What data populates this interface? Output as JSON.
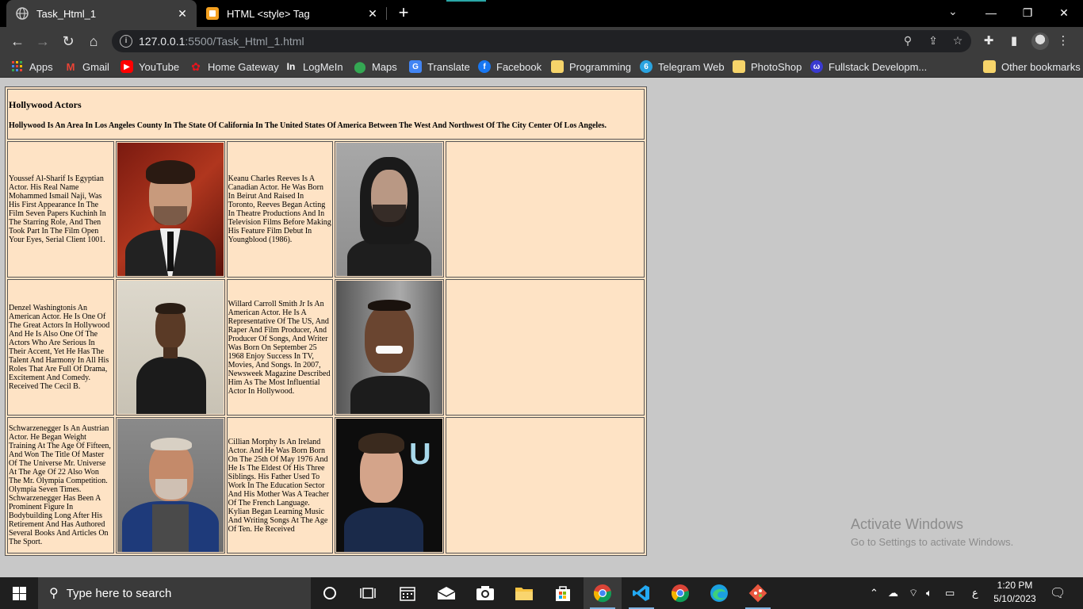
{
  "browser": {
    "tabs": [
      {
        "title": "Task_Html_1",
        "active": true,
        "icon": "globe-icon"
      },
      {
        "title": "HTML <style> Tag",
        "active": false,
        "icon": "w3schools-icon"
      }
    ],
    "url_host": "127.0.0.1",
    "url_path": ":5500/Task_Html_1.html",
    "bookmarks": [
      {
        "label": "Apps",
        "icon": "apps-grid-icon"
      },
      {
        "label": "Gmail",
        "icon": "gmail-icon"
      },
      {
        "label": "YouTube",
        "icon": "youtube-icon"
      },
      {
        "label": "Home Gateway",
        "icon": "huawei-icon"
      },
      {
        "label": "LogMeIn",
        "icon": "logmein-icon"
      },
      {
        "label": "Maps",
        "icon": "maps-icon"
      },
      {
        "label": "Translate",
        "icon": "translate-icon"
      },
      {
        "label": "Facebook",
        "icon": "facebook-icon"
      },
      {
        "label": "Programming",
        "icon": "folder-icon"
      },
      {
        "label": "Telegram Web",
        "icon": "telegram-icon"
      },
      {
        "label": "PhotoShop",
        "icon": "folder-icon"
      },
      {
        "label": "Fullstack Developm...",
        "icon": "fullstack-icon"
      },
      {
        "label": "Other bookmarks",
        "icon": "folder-icon"
      }
    ]
  },
  "page": {
    "heading": "Hollywood Actors",
    "subheading": "Hollywood Is An Area In Los Angeles County In The State Of California In The United States Of America Between The West And Northwest Of The City Center Of Los Angeles.",
    "rows": [
      {
        "left_bio": "Youssef Al-Sharif Is Egyptian Actor. His Real Name Mohammed Ismail Naji, Was His First Appearance In The Film Seven Papers Kuchinh In The Starring Role, And Then Took Part In The Film Open Your Eyes, Serial Client 1001.",
        "right_bio": "Keanu Charles Reeves Is A Canadian Actor. He Was Born In Beirut And Raised In Toronto, Reeves Began Acting In Theatre Productions And In Television Films Before Making His Feature Film Debut In Youngblood (1986)."
      },
      {
        "left_bio": "Denzel Washingtonis An American Actor. He Is One Of The Great Actors In Hollywood And He Is Also One Of The Actors Who Are Serious In Their Accent, Yet He Has The Talent And Harmony In All His Roles That Are Full Of Drama, Excitement And Comedy. Received The Cecil B.",
        "right_bio": "Willard Carroll Smith Jr Is An American Actor. He Is A Representative Of The US, And Raper And Film Producer, And Producer Of Songs, And Writer Was Born On September 25 1968 Enjoy Success In TV, Movies, And Songs. In 2007, Newsweek Magazine Described Him As The Most Influential Actor In Hollywood."
      },
      {
        "left_bio": "Schwarzenegger Is An Austrian Actor. He Began Weight Training At The Age Of Fifteen, And Won The Title Of Master Of The Universe Mr. Universe At The Age Of 22 Also Won The Mr. Olympia Competition. Olympia Seven Times. Schwarzenegger Has Been A Prominent Figure In Bodybuilding Long After His Retirement And Has Authored Several Books And Articles On The Sport.",
        "right_bio": "Cillian Morphy Is An Ireland Actor. And He Was Born Born On The 25th Of May 1976 And He Is The Eldest Of His Three Siblings. His Father Used To Work In The Education Sector And His Mother Was A Teacher Of The French Language. Kylian Began Learning Music And Writing Songs At The Age Of Ten. He Received"
      }
    ]
  },
  "watermark": {
    "title": "Activate Windows",
    "subtitle": "Go to Settings to activate Windows."
  },
  "taskbar": {
    "search_placeholder": "Type here to search",
    "time": "1:20 PM",
    "date": "5/10/2023",
    "language": "ع"
  }
}
